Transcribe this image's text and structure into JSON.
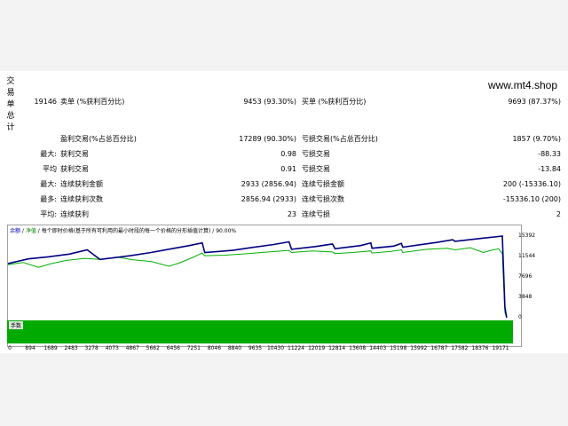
{
  "site_url": "www.mt4.shop",
  "side_label": "交易单总计",
  "stats": {
    "total_trades": "19146",
    "short_label": "卖单 (%获利百分比)",
    "short_value": "9453 (93.30%)",
    "long_label": "买单 (%获利百分比)",
    "long_value": "9693 (87.37%)",
    "profit_trades_label": "盈利交易(%占总百分比)",
    "profit_trades_value": "17289 (90.30%)",
    "loss_trades_label": "亏损交易(%占总百分比)",
    "loss_trades_value": "1857 (9.70%)",
    "largest_prefix": "最大:",
    "largest_profit_label": "获利交易",
    "largest_profit_value": "0.98",
    "largest_loss_label": "亏损交易",
    "largest_loss_value": "-88.33",
    "average_prefix": "平均",
    "average_profit_label": "获利交易",
    "average_profit_value": "0.91",
    "average_loss_label": "亏损交易",
    "average_loss_value": "-13.84",
    "max_prefix": "最大:",
    "max_cons_wins_label": "连续获利金额",
    "max_cons_wins_value": "2933 (2856.94)",
    "max_cons_losses_label": "连续亏损金额",
    "max_cons_losses_value": "200 (-15336.10)",
    "maximal_prefix": "最多:",
    "maximal_cons_profit_label": "连续获利次数",
    "maximal_cons_profit_value": "2856.94 (2933)",
    "maximal_cons_loss_label": "连续亏损次数",
    "maximal_cons_loss_value": "-15336.10 (200)",
    "avg_prefix": "平均:",
    "avg_cons_wins_label": "连续获利",
    "avg_cons_wins_value": "23",
    "avg_cons_losses_label": "连续亏损",
    "avg_cons_losses_value": "2"
  },
  "chart_header": {
    "balance": "余额",
    "sep": " / ",
    "equity": "净值",
    "desc": " / 每个即时价格(基于所有可利用的最小时段的每一个价格的分形插值计算) / 90.00%"
  },
  "volume_label": "手数",
  "chart_data": {
    "type": "line",
    "x_ticks": [
      "0",
      "894",
      "1689",
      "2483",
      "3278",
      "4073",
      "4867",
      "5662",
      "6456",
      "7251",
      "8046",
      "8840",
      "9635",
      "10430",
      "11224",
      "12019",
      "12814",
      "13608",
      "14403",
      "15198",
      "15992",
      "16787",
      "17582",
      "18376",
      "19171"
    ],
    "y_ticks": [
      "15392",
      "11544",
      "7696",
      "3848",
      "0"
    ],
    "ylim": [
      0,
      15392
    ],
    "xlim": [
      0,
      19800
    ],
    "series": [
      {
        "name": "余额",
        "color": "#00007f",
        "x": [
          0,
          800,
          1600,
          2400,
          3100,
          3600,
          4800,
          5600,
          6400,
          7100,
          7600,
          7700,
          8800,
          9500,
          10400,
          11000,
          11100,
          12000,
          12700,
          12800,
          13800,
          14200,
          14250,
          15100,
          15400,
          15450,
          16800,
          17400,
          17500,
          18600,
          19200,
          19350,
          19450,
          19520
        ],
        "y": [
          10200,
          11100,
          11500,
          12000,
          12800,
          11000,
          11700,
          12300,
          13000,
          13600,
          14100,
          12300,
          12700,
          13200,
          13800,
          14300,
          12900,
          13400,
          13900,
          13000,
          13600,
          14100,
          13100,
          13500,
          14000,
          13300,
          14200,
          14700,
          14400,
          15000,
          15300,
          15400,
          2000,
          0
        ]
      },
      {
        "name": "净值",
        "color": "#00b000",
        "x": [
          0,
          600,
          1200,
          1700,
          2300,
          3000,
          3600,
          4300,
          4900,
          5600,
          6300,
          6700,
          7200,
          7600,
          7700,
          8500,
          9400,
          10200,
          11000,
          11100,
          11900,
          12700,
          12800,
          13500,
          14200,
          14250,
          15000,
          15400,
          15450,
          16400,
          17200,
          17500,
          18100,
          18600,
          18900,
          19200,
          19350,
          19450,
          19520
        ],
        "y": [
          10000,
          10400,
          9500,
          10200,
          10800,
          11200,
          11000,
          11400,
          10900,
          10600,
          9700,
          10300,
          11300,
          12200,
          11700,
          11800,
          12100,
          12400,
          12700,
          12300,
          12600,
          12400,
          12100,
          12300,
          12600,
          12200,
          12500,
          12800,
          12300,
          12900,
          13100,
          12800,
          13200,
          12300,
          12700,
          13000,
          12100,
          1000,
          0
        ]
      }
    ]
  }
}
